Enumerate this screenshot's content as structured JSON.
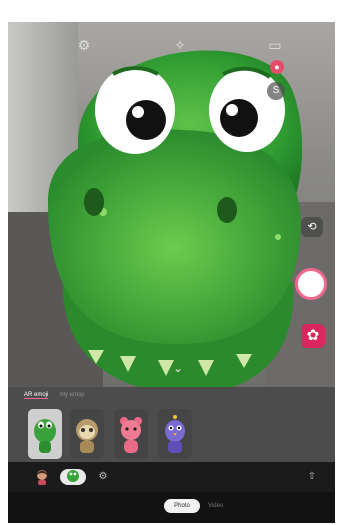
{
  "topbar": {
    "icons": [
      "settings-icon",
      "effects-icon",
      "aspect-ratio-icon"
    ]
  },
  "side_controls": {
    "icons": [
      "profile-icon",
      "sticker-icon",
      "switch-camera-icon",
      "flower-effect-icon"
    ],
    "accent_color": "#d9265c",
    "shutter_ring_color": "#f06a8f"
  },
  "tray": {
    "tabs": [
      "AR emoji",
      "My emoji"
    ],
    "items": [
      "dino-green",
      "sloth",
      "pink-bear",
      "bird-purple"
    ]
  },
  "bottombar": {
    "items": [
      "avatar-icon",
      "dino-icon",
      "gallery-settings-icon",
      "share-icon"
    ]
  },
  "modes": {
    "active": "Photo",
    "other": "Video"
  }
}
